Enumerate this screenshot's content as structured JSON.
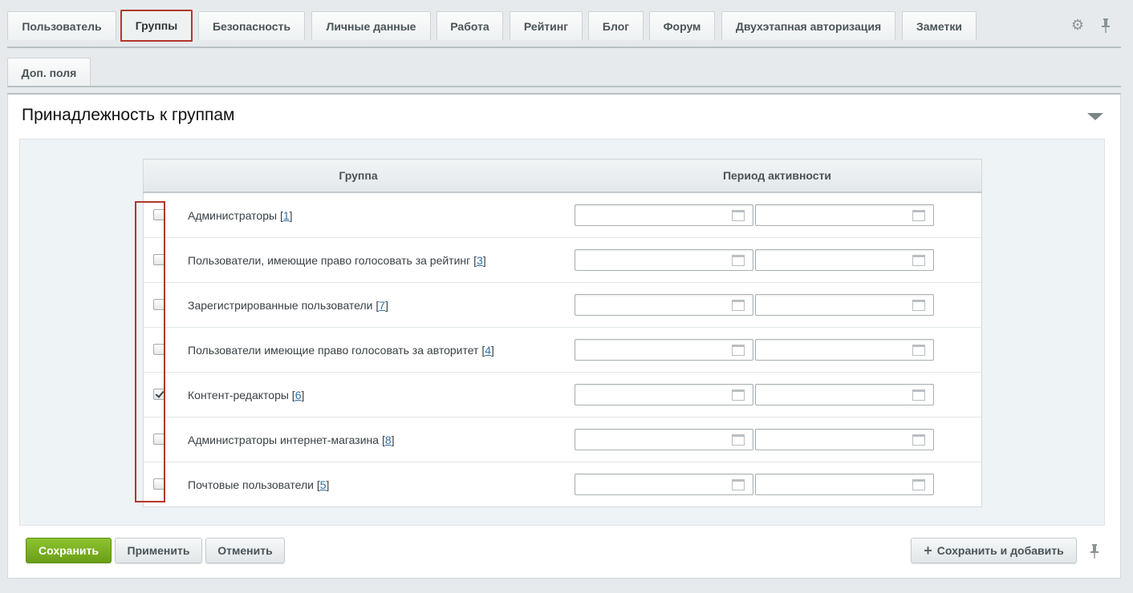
{
  "tabs": [
    "Пользователь",
    "Группы",
    "Безопасность",
    "Личные данные",
    "Работа",
    "Рейтинг",
    "Блог",
    "Форум",
    "Двухэтапная авторизация",
    "Заметки"
  ],
  "tabs_row2": [
    "Доп. поля"
  ],
  "active_tab": "Группы",
  "section_title": "Принадлежность к группам",
  "table": {
    "col_group": "Группа",
    "col_period": "Период активности",
    "rows": [
      {
        "name": "Администраторы",
        "id": "1",
        "checked": false
      },
      {
        "name": "Пользователи, имеющие право голосовать за рейтинг",
        "id": "3",
        "checked": false
      },
      {
        "name": "Зарегистрированные пользователи",
        "id": "7",
        "checked": false
      },
      {
        "name": "Пользователи имеющие право голосовать за авторитет",
        "id": "4",
        "checked": false
      },
      {
        "name": "Контент-редакторы",
        "id": "6",
        "checked": true
      },
      {
        "name": "Администраторы интернет-магазина",
        "id": "8",
        "checked": false
      },
      {
        "name": "Почтовые пользователи",
        "id": "5",
        "checked": false
      }
    ]
  },
  "footer": {
    "save": "Сохранить",
    "apply": "Применить",
    "cancel": "Отменить",
    "save_add": "Сохранить и добавить"
  },
  "icons": {
    "settings": "gear-icon",
    "pin": "pin-icon",
    "calendar": "calendar-icon",
    "collapse": "triangle-down-icon"
  },
  "colors": {
    "highlight": "#b2372b",
    "save_button": "#7ab320",
    "link": "#2f6ea5"
  }
}
